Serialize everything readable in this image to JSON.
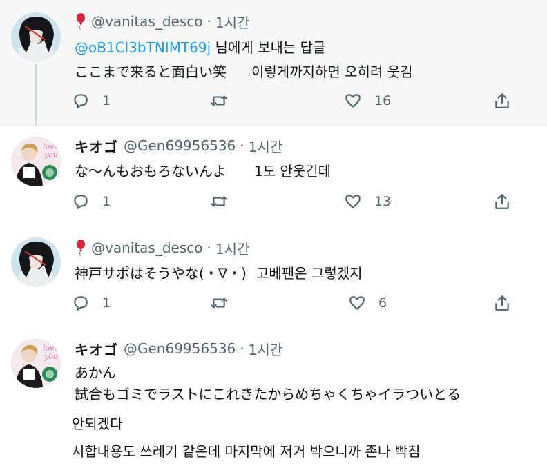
{
  "tweets": [
    {
      "author_handle": "@vanitas_desco",
      "time": "1시간",
      "reply_to_mention": "@oB1Cl3bTNIMT69j",
      "reply_to_suffix": " 님에게 보내는 답글",
      "text_original": "ここまで来ると面白い笑",
      "text_translation": "이렇게까지하면 오히려 웃김",
      "replies": "1",
      "likes": "16"
    },
    {
      "author_name": "キオゴ",
      "author_handle": "@Gen69956536",
      "time": "1시간",
      "text_original": "な～んもおもろないんよ",
      "text_translation": "1도 안웃긴데",
      "replies": "1",
      "likes": "13"
    },
    {
      "author_handle": "@vanitas_desco",
      "time": "1시간",
      "text_original": "神戸サポはそうやな(・∇・)",
      "text_translation": "고베팬은 그렇겠지",
      "replies": "1",
      "likes": "6"
    },
    {
      "author_name": "キオゴ",
      "author_handle": "@Gen69956536",
      "time": "1시간",
      "text_line1": "あかん",
      "text_line2": "試合もゴミでラストにこれきたからめちゃくちゃイラついとる",
      "translation_line1": "안되겠다",
      "translation_line2": "시합내용도 쓰레기 같은데 마지막에 저거 박으니까 존나 빡침"
    }
  ],
  "separator": "·",
  "colors": {
    "link": "#1d9bf0",
    "muted": "#536471",
    "highlight_bg": "#f7f9f9"
  },
  "icons": [
    "reply-icon",
    "retweet-icon",
    "like-icon",
    "share-icon",
    "balloon-icon"
  ]
}
